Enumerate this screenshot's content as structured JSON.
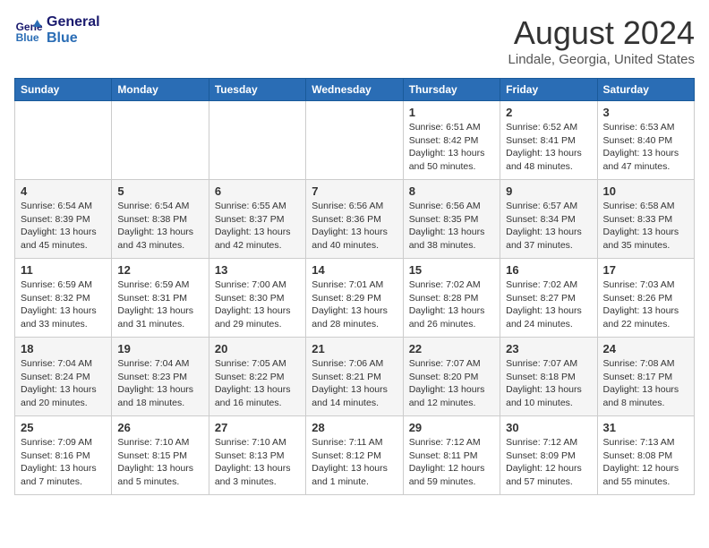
{
  "header": {
    "logo_line1": "General",
    "logo_line2": "Blue",
    "main_title": "August 2024",
    "subtitle": "Lindale, Georgia, United States"
  },
  "columns": [
    "Sunday",
    "Monday",
    "Tuesday",
    "Wednesday",
    "Thursday",
    "Friday",
    "Saturday"
  ],
  "weeks": [
    [
      {
        "day": "",
        "detail": ""
      },
      {
        "day": "",
        "detail": ""
      },
      {
        "day": "",
        "detail": ""
      },
      {
        "day": "",
        "detail": ""
      },
      {
        "day": "1",
        "detail": "Sunrise: 6:51 AM\nSunset: 8:42 PM\nDaylight: 13 hours\nand 50 minutes."
      },
      {
        "day": "2",
        "detail": "Sunrise: 6:52 AM\nSunset: 8:41 PM\nDaylight: 13 hours\nand 48 minutes."
      },
      {
        "day": "3",
        "detail": "Sunrise: 6:53 AM\nSunset: 8:40 PM\nDaylight: 13 hours\nand 47 minutes."
      }
    ],
    [
      {
        "day": "4",
        "detail": "Sunrise: 6:54 AM\nSunset: 8:39 PM\nDaylight: 13 hours\nand 45 minutes."
      },
      {
        "day": "5",
        "detail": "Sunrise: 6:54 AM\nSunset: 8:38 PM\nDaylight: 13 hours\nand 43 minutes."
      },
      {
        "day": "6",
        "detail": "Sunrise: 6:55 AM\nSunset: 8:37 PM\nDaylight: 13 hours\nand 42 minutes."
      },
      {
        "day": "7",
        "detail": "Sunrise: 6:56 AM\nSunset: 8:36 PM\nDaylight: 13 hours\nand 40 minutes."
      },
      {
        "day": "8",
        "detail": "Sunrise: 6:56 AM\nSunset: 8:35 PM\nDaylight: 13 hours\nand 38 minutes."
      },
      {
        "day": "9",
        "detail": "Sunrise: 6:57 AM\nSunset: 8:34 PM\nDaylight: 13 hours\nand 37 minutes."
      },
      {
        "day": "10",
        "detail": "Sunrise: 6:58 AM\nSunset: 8:33 PM\nDaylight: 13 hours\nand 35 minutes."
      }
    ],
    [
      {
        "day": "11",
        "detail": "Sunrise: 6:59 AM\nSunset: 8:32 PM\nDaylight: 13 hours\nand 33 minutes."
      },
      {
        "day": "12",
        "detail": "Sunrise: 6:59 AM\nSunset: 8:31 PM\nDaylight: 13 hours\nand 31 minutes."
      },
      {
        "day": "13",
        "detail": "Sunrise: 7:00 AM\nSunset: 8:30 PM\nDaylight: 13 hours\nand 29 minutes."
      },
      {
        "day": "14",
        "detail": "Sunrise: 7:01 AM\nSunset: 8:29 PM\nDaylight: 13 hours\nand 28 minutes."
      },
      {
        "day": "15",
        "detail": "Sunrise: 7:02 AM\nSunset: 8:28 PM\nDaylight: 13 hours\nand 26 minutes."
      },
      {
        "day": "16",
        "detail": "Sunrise: 7:02 AM\nSunset: 8:27 PM\nDaylight: 13 hours\nand 24 minutes."
      },
      {
        "day": "17",
        "detail": "Sunrise: 7:03 AM\nSunset: 8:26 PM\nDaylight: 13 hours\nand 22 minutes."
      }
    ],
    [
      {
        "day": "18",
        "detail": "Sunrise: 7:04 AM\nSunset: 8:24 PM\nDaylight: 13 hours\nand 20 minutes."
      },
      {
        "day": "19",
        "detail": "Sunrise: 7:04 AM\nSunset: 8:23 PM\nDaylight: 13 hours\nand 18 minutes."
      },
      {
        "day": "20",
        "detail": "Sunrise: 7:05 AM\nSunset: 8:22 PM\nDaylight: 13 hours\nand 16 minutes."
      },
      {
        "day": "21",
        "detail": "Sunrise: 7:06 AM\nSunset: 8:21 PM\nDaylight: 13 hours\nand 14 minutes."
      },
      {
        "day": "22",
        "detail": "Sunrise: 7:07 AM\nSunset: 8:20 PM\nDaylight: 13 hours\nand 12 minutes."
      },
      {
        "day": "23",
        "detail": "Sunrise: 7:07 AM\nSunset: 8:18 PM\nDaylight: 13 hours\nand 10 minutes."
      },
      {
        "day": "24",
        "detail": "Sunrise: 7:08 AM\nSunset: 8:17 PM\nDaylight: 13 hours\nand 8 minutes."
      }
    ],
    [
      {
        "day": "25",
        "detail": "Sunrise: 7:09 AM\nSunset: 8:16 PM\nDaylight: 13 hours\nand 7 minutes."
      },
      {
        "day": "26",
        "detail": "Sunrise: 7:10 AM\nSunset: 8:15 PM\nDaylight: 13 hours\nand 5 minutes."
      },
      {
        "day": "27",
        "detail": "Sunrise: 7:10 AM\nSunset: 8:13 PM\nDaylight: 13 hours\nand 3 minutes."
      },
      {
        "day": "28",
        "detail": "Sunrise: 7:11 AM\nSunset: 8:12 PM\nDaylight: 13 hours\nand 1 minute."
      },
      {
        "day": "29",
        "detail": "Sunrise: 7:12 AM\nSunset: 8:11 PM\nDaylight: 12 hours\nand 59 minutes."
      },
      {
        "day": "30",
        "detail": "Sunrise: 7:12 AM\nSunset: 8:09 PM\nDaylight: 12 hours\nand 57 minutes."
      },
      {
        "day": "31",
        "detail": "Sunrise: 7:13 AM\nSunset: 8:08 PM\nDaylight: 12 hours\nand 55 minutes."
      }
    ]
  ]
}
